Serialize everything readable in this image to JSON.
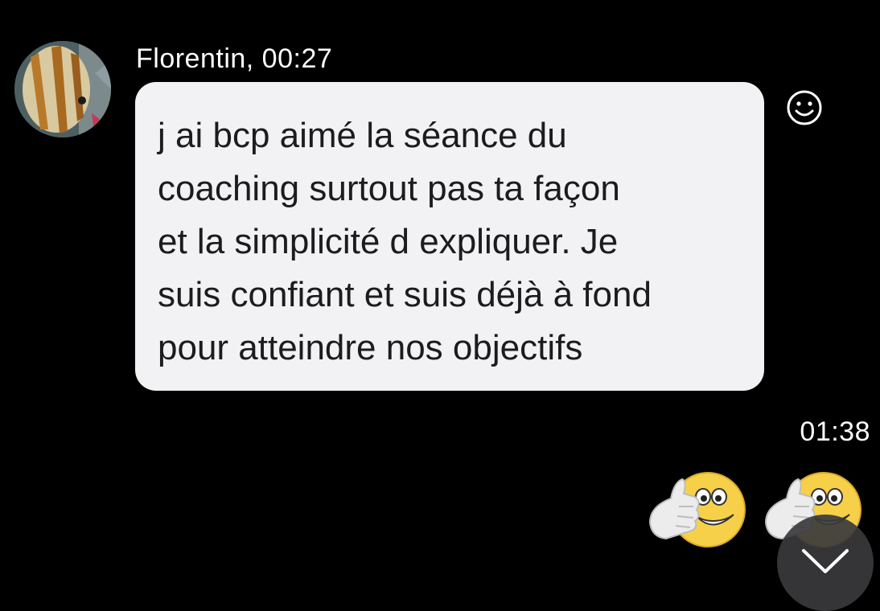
{
  "message": {
    "sender": "Florentin",
    "time": "00:27",
    "sender_line": "Florentin, 00:27",
    "text_lines": [
      "j ai bcp aimé la séance du",
      "coaching surtout pas ta façon",
      "et la simplicité d expliquer. Je",
      "suis confiant et suis déjà à fond",
      "pour atteindre nos objectifs"
    ]
  },
  "reply": {
    "time": "01:38",
    "stickers": [
      "thumbs-up-smiley-sticker",
      "thumbs-up-smiley-sticker"
    ]
  },
  "icons": {
    "avatar": "fish-avatar",
    "reaction": "smiley-reaction-icon",
    "scroll_down": "chevron-down-icon"
  },
  "colors": {
    "background": "#000000",
    "bubble": "#f2f2f4",
    "bubble_text": "#1c1c1e",
    "meta_text": "#ffffff",
    "scroll_button": "#3a3a3c",
    "sticker_face": "#f7d04a"
  }
}
